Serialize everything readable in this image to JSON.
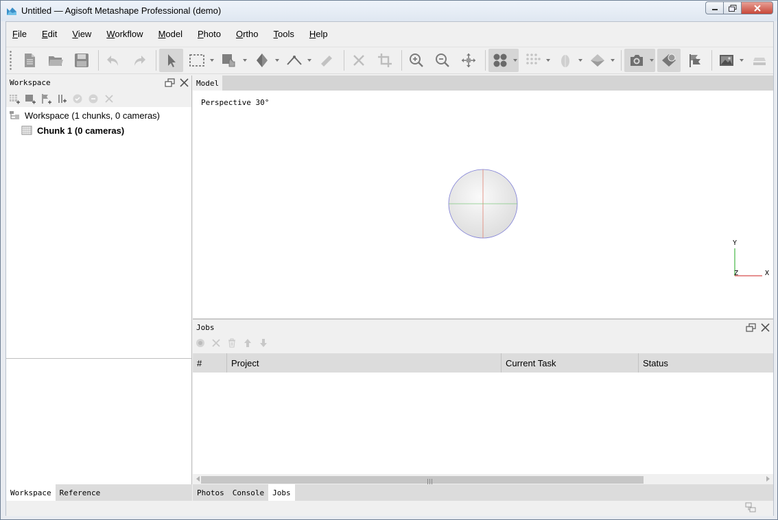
{
  "window": {
    "title": "Untitled — Agisoft Metashape Professional (demo)"
  },
  "menu": [
    {
      "label": "File",
      "accel": "F",
      "rest": "ile"
    },
    {
      "label": "Edit",
      "accel": "E",
      "rest": "dit"
    },
    {
      "label": "View",
      "accel": "V",
      "rest": "iew"
    },
    {
      "label": "Workflow",
      "accel": "W",
      "rest": "orkflow"
    },
    {
      "label": "Model",
      "accel": "M",
      "rest": "odel"
    },
    {
      "label": "Photo",
      "accel": "P",
      "rest": "hoto"
    },
    {
      "label": "Ortho",
      "accel": "O",
      "rest": "rtho"
    },
    {
      "label": "Tools",
      "accel": "T",
      "rest": "ools"
    },
    {
      "label": "Help",
      "accel": "H",
      "rest": "elp"
    }
  ],
  "workspace": {
    "header": "Workspace",
    "root_label": "Workspace (1 chunks, 0 cameras)",
    "chunk_label": "Chunk 1 (0 cameras)",
    "tabs": [
      "Workspace",
      "Reference"
    ]
  },
  "model": {
    "tab": "Model",
    "projection": "Perspective 30°",
    "axis_labels": {
      "y": "Y",
      "z": "Z",
      "x": "X"
    }
  },
  "jobs": {
    "title": "Jobs",
    "columns": [
      "#",
      "Project",
      "Current Task",
      "Status"
    ],
    "tabs": [
      "Photos",
      "Console",
      "Jobs"
    ]
  },
  "colors": {
    "sphere_outline": "#7b7bd6",
    "axis_x": "#cc2222",
    "axis_y": "#22aa22"
  }
}
